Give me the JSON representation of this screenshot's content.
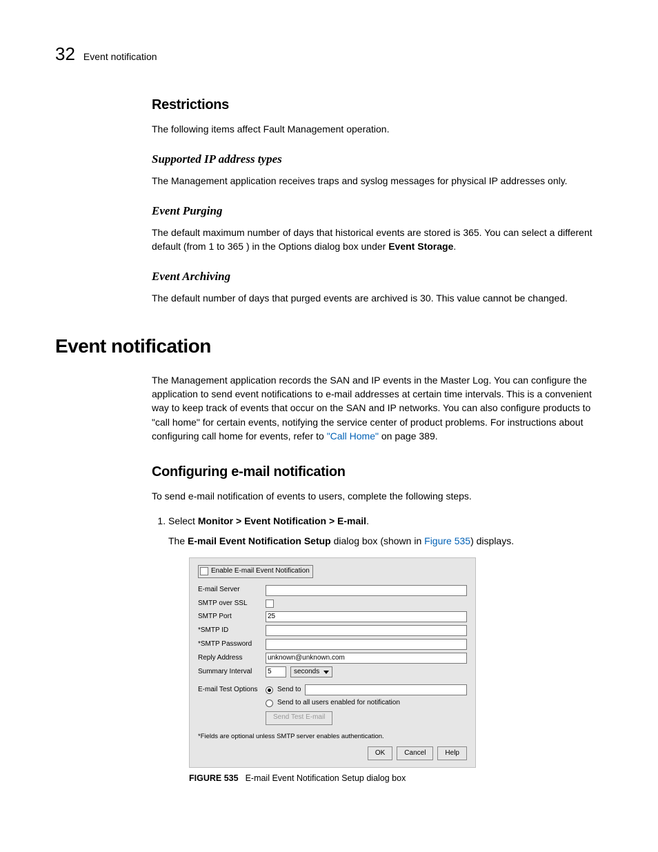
{
  "header": {
    "page_number": "32",
    "title": "Event notification"
  },
  "restrictions": {
    "heading": "Restrictions",
    "intro": "The following items affect Fault Management operation.",
    "supported_ip": {
      "heading": "Supported IP address types",
      "body": "The Management application receives traps and syslog messages for physical IP addresses only."
    },
    "event_purging": {
      "heading": "Event Purging",
      "body_pre": "The default maximum number of days that historical events are stored is 365. You can select a different default (from 1 to 365 ) in the Options dialog box under ",
      "body_bold": "Event Storage",
      "body_post": "."
    },
    "event_archiving": {
      "heading": "Event Archiving",
      "body": "The default number of days that purged events are archived is 30. This value cannot be changed."
    }
  },
  "event_notification": {
    "heading": "Event notification",
    "body_pre": "The Management application records the SAN and IP events in the Master Log. You can configure the application to send event notifications to e-mail addresses at certain time intervals. This is a convenient way to keep track of events that occur on the SAN and IP networks. You can also configure products to \"call home\" for certain events, notifying the service center of product problems. For instructions about configuring call home for events, refer to ",
    "link_text": "\"Call Home\"",
    "body_post": " on page 389."
  },
  "configuring": {
    "heading": "Configuring e-mail notification",
    "intro": "To send e-mail notification of events to users, complete the following steps.",
    "step1_pre": "Select ",
    "step1_bold": "Monitor > Event Notification > E-mail",
    "step1_post": ".",
    "step1_body_pre": "The ",
    "step1_body_bold": "E-mail Event Notification Setup",
    "step1_body_mid": " dialog box (shown in ",
    "step1_body_link": "Figure 535",
    "step1_body_post": ") displays."
  },
  "dialog": {
    "enable_label": "Enable E-mail Event Notification",
    "rows": {
      "email_server": "E-mail Server",
      "smtp_ssl": "SMTP over SSL",
      "smtp_port": "SMTP Port",
      "smtp_port_value": "25",
      "smtp_id": "*SMTP ID",
      "smtp_password": "*SMTP Password",
      "reply_address": "Reply Address",
      "reply_address_value": "unknown@unknown.com",
      "summary_interval": "Summary Interval",
      "summary_interval_value": "5",
      "summary_interval_unit": "seconds",
      "test_options": "E-mail Test Options",
      "send_to": "Send to",
      "send_all": "Send to all users enabled for notification",
      "send_test_btn": "Send Test E-mail"
    },
    "footnote": "*Fields are optional unless SMTP server enables authentication.",
    "buttons": {
      "ok": "OK",
      "cancel": "Cancel",
      "help": "Help"
    }
  },
  "figure": {
    "label": "FIGURE 535",
    "caption": "E-mail Event Notification Setup dialog box"
  }
}
